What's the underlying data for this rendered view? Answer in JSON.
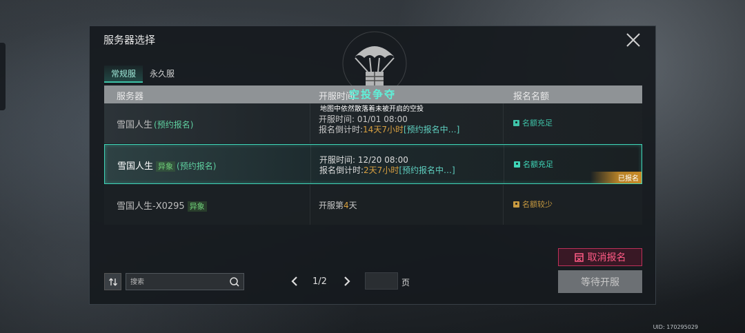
{
  "panel": {
    "title": "服务器选择",
    "tabs": [
      {
        "label": "常规服",
        "active": true
      },
      {
        "label": "永久服",
        "active": false
      }
    ]
  },
  "table": {
    "headers": [
      "服务器",
      "开服时间",
      "报名名额"
    ]
  },
  "event": {
    "title": "空投争夺",
    "description": "地图中依然散落着未被开启的空投"
  },
  "rows": [
    {
      "name": "雪国人生",
      "tag": "",
      "reserve": "(预约报名)",
      "time_line1": "开服时间: 01/01 08:00",
      "time_line2_prefix": "报名倒计时:",
      "time_line2_countdown": "14天7小时",
      "time_line2_status": "[预约报名中…]",
      "quota": "名额充足",
      "quota_color": "#3fc3a8",
      "selected": false
    },
    {
      "name": "雪国人生",
      "tag": "异象",
      "reserve": "(预约报名)",
      "time_line1": "开服时间: 12/20 08:00",
      "time_line2_prefix": "报名倒计时:",
      "time_line2_countdown": "2天7小时",
      "time_line2_status": "[预约报名中…]",
      "quota": "名额充足",
      "quota_color": "#3fc3a8",
      "badge": "已报名",
      "selected": true
    },
    {
      "name": "雪国人生-X0295",
      "tag": "异象",
      "time_prefix": "开服第",
      "time_days": "4",
      "time_suffix": "天",
      "quota": "名额较少",
      "quota_color": "#c89a40",
      "selected": false
    }
  ],
  "buttons": {
    "cancel": "取消报名",
    "wait": "等待开服"
  },
  "search": {
    "placeholder": "搜索"
  },
  "pager": {
    "text": "1/2",
    "page_label": "页"
  },
  "uid": "UID: 170295029",
  "icons": {
    "close": "close-icon",
    "sort": "sort-icon",
    "search": "search-icon",
    "prev": "chevron-left-icon",
    "next": "chevron-right-icon",
    "quota": "user-icon",
    "emblem": "parachute-crate-icon",
    "cancel": "cancel-calendar-icon"
  },
  "colors": {
    "accent": "#3fd6b8",
    "cancel": "#ff5a85",
    "badge": "#c88a28"
  }
}
